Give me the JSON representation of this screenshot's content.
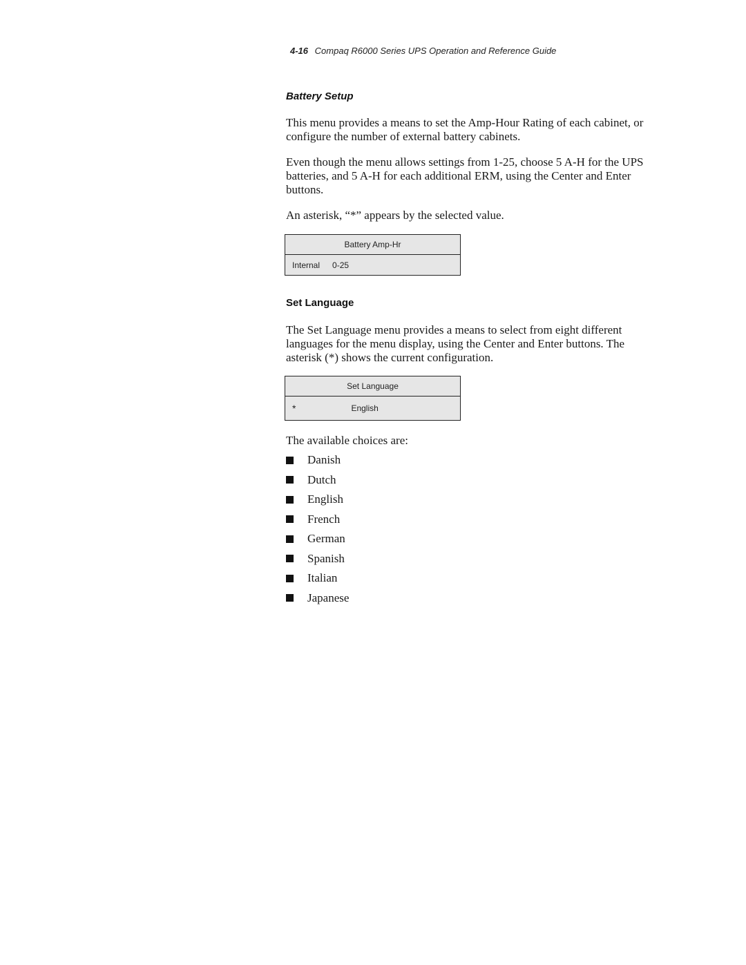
{
  "page_header": {
    "page_number": "4-16",
    "title": "Compaq R6000 Series UPS Operation and Reference Guide"
  },
  "battery_setup": {
    "heading": "Battery Setup",
    "paragraphs": [
      "This menu provides a means to set the Amp-Hour Rating of each cabinet, or configure the number of external battery cabinets.",
      "Even though the menu allows settings from 1-25, choose 5 A-H for the UPS batteries, and 5 A-H for each additional ERM, using the Center and Enter buttons.",
      "An asterisk, “*” appears by the selected value."
    ],
    "display": {
      "title": "Battery Amp-Hr",
      "label": "Internal",
      "value": "0-25"
    }
  },
  "set_language": {
    "heading": "Set Language",
    "paragraph": "The Set Language menu provides a means to select from eight different languages for the menu display, using the Center and Enter buttons. The asterisk (*) shows the current configuration.",
    "display": {
      "title": "Set Language",
      "marker": "*",
      "value": "English"
    },
    "choices_intro": "The available choices are:",
    "choices": [
      "Danish",
      "Dutch",
      "English",
      "French",
      "German",
      "Spanish",
      "Italian",
      "Japanese"
    ]
  }
}
